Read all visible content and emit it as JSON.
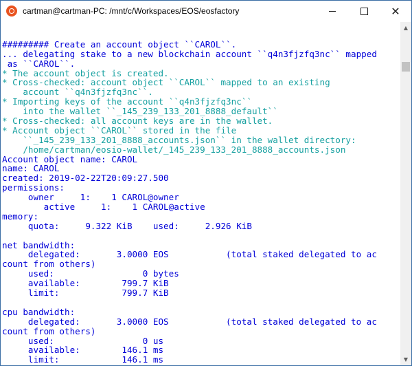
{
  "window": {
    "title": "cartman@cartman-PC: /mnt/c/Workspaces/EOS/eosfactory",
    "app_icon": "ubuntu-icon",
    "controls": {
      "minimize": "minimize-icon",
      "maximize": "maximize-icon",
      "close": "✕"
    }
  },
  "terminal": {
    "lines": [
      {
        "text": "",
        "color": "blue"
      },
      {
        "text": "######### Create an account object ``CAROL``.",
        "color": "blue"
      },
      {
        "text": "... delegating stake to a new blockchain account ``q4n3fjzfq3nc`` mapped",
        "color": "blue"
      },
      {
        "text": " as ``CAROL``.",
        "color": "blue"
      },
      {
        "text": "* The account object is created.",
        "color": "teal"
      },
      {
        "text": "* Cross-checked: account object ``CAROL`` mapped to an existing",
        "color": "teal"
      },
      {
        "text": "    account ``q4n3fjzfq3nc``.",
        "color": "teal"
      },
      {
        "text": "* Importing keys of the account ``q4n3fjzfq3nc``",
        "color": "teal"
      },
      {
        "text": "    into the wallet ``_145_239_133_201_8888_default``",
        "color": "teal"
      },
      {
        "text": "* Cross-checked: all account keys are in the wallet.",
        "color": "teal"
      },
      {
        "text": "* Account object ``CAROL`` stored in the file",
        "color": "teal"
      },
      {
        "text": "    ``_145_239_133_201_8888_accounts.json`` in the wallet directory:",
        "color": "teal"
      },
      {
        "text": "    /home/cartman/eosio-wallet/_145_239_133_201_8888_accounts.json",
        "color": "teal"
      },
      {
        "text": "Account object name: CAROL",
        "color": "blue"
      },
      {
        "text": "name: CAROL",
        "color": "blue"
      },
      {
        "text": "created: 2019-02-22T20:09:27.500",
        "color": "blue"
      },
      {
        "text": "permissions:",
        "color": "blue"
      },
      {
        "text": "     owner     1:    1 CAROL@owner",
        "color": "blue"
      },
      {
        "text": "        active     1:    1 CAROL@active",
        "color": "blue"
      },
      {
        "text": "memory:",
        "color": "blue"
      },
      {
        "text": "     quota:     9.322 KiB    used:     2.926 KiB",
        "color": "blue"
      },
      {
        "text": "",
        "color": "blue"
      },
      {
        "text": "net bandwidth:",
        "color": "blue"
      },
      {
        "text": "     delegated:       3.0000 EOS           (total staked delegated to ac",
        "color": "blue"
      },
      {
        "text": "count from others)",
        "color": "blue"
      },
      {
        "text": "     used:                 0 bytes",
        "color": "blue"
      },
      {
        "text": "     available:        799.7 KiB",
        "color": "blue"
      },
      {
        "text": "     limit:            799.7 KiB",
        "color": "blue"
      },
      {
        "text": "",
        "color": "blue"
      },
      {
        "text": "cpu bandwidth:",
        "color": "blue"
      },
      {
        "text": "     delegated:       3.0000 EOS           (total staked delegated to ac",
        "color": "blue"
      },
      {
        "text": "count from others)",
        "color": "blue"
      },
      {
        "text": "     used:                 0 us",
        "color": "blue"
      },
      {
        "text": "     available:        146.1 ms",
        "color": "blue"
      },
      {
        "text": "     limit:            146.1 ms",
        "color": "blue"
      }
    ]
  },
  "colors": {
    "blue": "#0000d7",
    "teal": "#16a0a0"
  },
  "scrollbar": {
    "up": "▲",
    "down": "▼"
  }
}
